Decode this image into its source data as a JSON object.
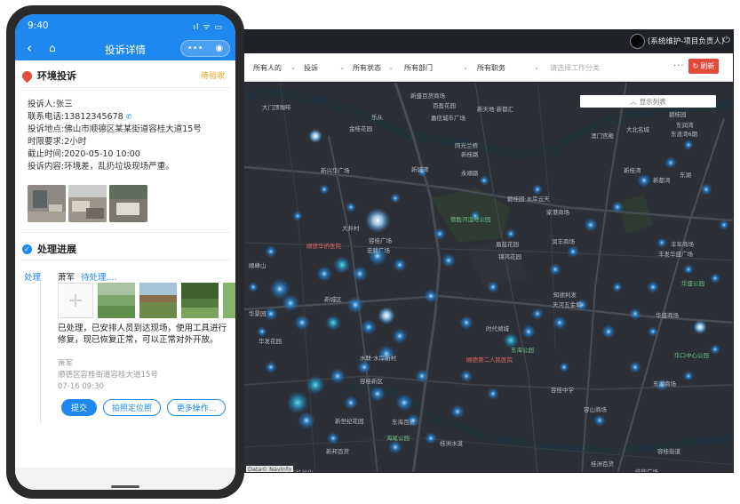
{
  "desktop": {
    "user_label": "(系统维护-项目负责人)",
    "filters": [
      {
        "label": "所有人的",
        "placeholder": false
      },
      {
        "label": "投诉",
        "placeholder": false
      },
      {
        "label": "所有状态",
        "placeholder": false
      },
      {
        "label": "所有部门",
        "placeholder": false
      },
      {
        "label": "所有职务",
        "placeholder": false
      },
      {
        "label": "请选择工作分类",
        "placeholder": true
      }
    ],
    "more_label": "···",
    "refresh_label": "刷新",
    "list_toggle_label": "显示列表",
    "attribution": "Data© NavInfo",
    "map_labels": [
      {
        "text": "大门顶咖啡",
        "cls": ""
      },
      {
        "text": "新盛百货商场",
        "cls": ""
      },
      {
        "text": "百盈花园",
        "cls": ""
      },
      {
        "text": "嘉信城市广场",
        "cls": ""
      },
      {
        "text": "新天地·新都汇",
        "cls": ""
      },
      {
        "text": "金桂花园",
        "cls": ""
      },
      {
        "text": "澳门宫殿",
        "cls": ""
      },
      {
        "text": "大北名城",
        "cls": ""
      },
      {
        "text": "乐从",
        "cls": ""
      },
      {
        "text": "碧桂园",
        "cls": ""
      },
      {
        "text": "东润湾",
        "cls": ""
      },
      {
        "text": "东浪湾6期",
        "cls": ""
      },
      {
        "text": "新桂湾",
        "cls": ""
      },
      {
        "text": "东湖",
        "cls": ""
      },
      {
        "text": "新都湾",
        "cls": ""
      },
      {
        "text": "同光兰桥",
        "cls": ""
      },
      {
        "text": "新桂路",
        "cls": ""
      },
      {
        "text": "永顺路",
        "cls": ""
      },
      {
        "text": "新城湾",
        "cls": ""
      },
      {
        "text": "新兴华广场",
        "cls": ""
      },
      {
        "text": "碧桂园·水岸云天",
        "cls": ""
      },
      {
        "text": "德胜河湿地公园",
        "cls": "green"
      },
      {
        "text": "家港商场",
        "cls": ""
      },
      {
        "text": "润丰商场",
        "cls": ""
      },
      {
        "text": "顺德华侨医院",
        "cls": "red"
      },
      {
        "text": "容桂广场",
        "cls": ""
      },
      {
        "text": "大井村",
        "cls": ""
      },
      {
        "text": "宏骏广场",
        "cls": ""
      },
      {
        "text": "眉蓝花园",
        "cls": ""
      },
      {
        "text": "锦鸿花园",
        "cls": ""
      },
      {
        "text": "丰年商场",
        "cls": ""
      },
      {
        "text": "丰发华盛广场",
        "cls": ""
      },
      {
        "text": "华盛公园",
        "cls": "green"
      },
      {
        "text": "顺峰山",
        "cls": ""
      },
      {
        "text": "知德利发",
        "cls": ""
      },
      {
        "text": "天河五金城",
        "cls": ""
      },
      {
        "text": "时代倾城",
        "cls": ""
      },
      {
        "text": "华景园",
        "cls": ""
      },
      {
        "text": "新城区",
        "cls": ""
      },
      {
        "text": "华盛商场",
        "cls": ""
      },
      {
        "text": "华发花园",
        "cls": ""
      },
      {
        "text": "东海公园",
        "cls": "green"
      },
      {
        "text": "顺德第二人民医院",
        "cls": "red"
      },
      {
        "text": "水联·水岸新村",
        "cls": ""
      },
      {
        "text": "华口中心公园",
        "cls": "green"
      },
      {
        "text": "东湖商场",
        "cls": ""
      },
      {
        "text": "容桂中学",
        "cls": ""
      },
      {
        "text": "容山商场",
        "cls": ""
      },
      {
        "text": "容桂新区",
        "cls": ""
      },
      {
        "text": "新世纪花园",
        "cls": ""
      },
      {
        "text": "东海百货",
        "cls": ""
      },
      {
        "text": "桂洲水道",
        "cls": ""
      },
      {
        "text": "新邦百货",
        "cls": ""
      },
      {
        "text": "容桂街道",
        "cls": ""
      },
      {
        "text": "广东桂兰化",
        "cls": ""
      },
      {
        "text": "桂洲百货",
        "cls": ""
      },
      {
        "text": "海尾公园",
        "cls": "green"
      },
      {
        "text": "佳能广场",
        "cls": ""
      },
      {
        "text": "新桂花园",
        "cls": ""
      }
    ]
  },
  "phone": {
    "time": "9:40",
    "status_icons": "ıl ᯤ ▭",
    "title": "投诉详情",
    "section1_title": "环境投诉",
    "status_tag": "待验收",
    "complainant_label": "投诉人:",
    "complainant": "张三",
    "phone_label": "联系电话:",
    "phone": "13812345678",
    "address_label": "投诉地点:",
    "address": "佛山市顺德区某某街道容桂大道15号",
    "limit_label": "时限要求:",
    "limit": "2小时",
    "deadline_label": "截止时间:",
    "deadline": "2020-05-10 10:00",
    "content_label": "投诉内容:",
    "content": "环境差，乱扔垃圾现场严重。",
    "section2_title": "处理进展",
    "tab_process": "处理",
    "handler": "萧军",
    "handler_status": "待处理....",
    "desc": "已处理，已安排人员到达现场，使用工具进行修复，现已恢复正常，可以正常对外开放。",
    "meta_name": "萧军",
    "meta_address": "顺德区容桂街道容桂大道15号",
    "meta_time": "07-16 09:30",
    "btn_submit": "提交",
    "btn_photo": "拍照定位照",
    "btn_more": "更多操作..."
  }
}
